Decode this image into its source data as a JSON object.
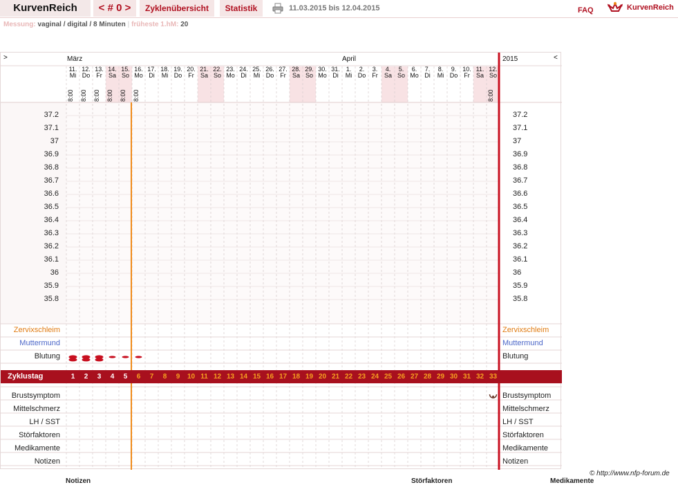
{
  "topbar": {
    "brand": "KurvenReich",
    "nav": "< # 0 >",
    "cycles": "Zyklenübersicht",
    "stats": "Statistik",
    "range": "11.03.2015 bis 12.04.2015",
    "faq": "FAQ",
    "logo": "KurvenReich"
  },
  "info": {
    "measure_label": "Messung:",
    "measure_value": "vaginal / digital / 8 Minuten",
    "sep": "|",
    "earliest_label": "früheste 1.hM:",
    "earliest_value": "20"
  },
  "chart": {
    "left_arrow": ">",
    "right_arrow": "<",
    "month1": "März",
    "month2": "April",
    "year": "2015",
    "days": [
      {
        "d": "11.",
        "w": "Mi",
        "t": "8:00",
        "we": false
      },
      {
        "d": "12.",
        "w": "Do",
        "t": "8:00",
        "we": false
      },
      {
        "d": "13.",
        "w": "Fr",
        "t": "8:00",
        "we": false
      },
      {
        "d": "14.",
        "w": "Sa",
        "t": "8:00",
        "we": true
      },
      {
        "d": "15.",
        "w": "So",
        "t": "8:00",
        "we": true
      },
      {
        "d": "16.",
        "w": "Mo",
        "t": "8:00",
        "we": false
      },
      {
        "d": "17.",
        "w": "Di",
        "t": "",
        "we": false
      },
      {
        "d": "18.",
        "w": "Mi",
        "t": "",
        "we": false
      },
      {
        "d": "19.",
        "w": "Do",
        "t": "",
        "we": false
      },
      {
        "d": "20.",
        "w": "Fr",
        "t": "",
        "we": false
      },
      {
        "d": "21.",
        "w": "Sa",
        "t": "",
        "we": true
      },
      {
        "d": "22.",
        "w": "So",
        "t": "",
        "we": true
      },
      {
        "d": "23.",
        "w": "Mo",
        "t": "",
        "we": false
      },
      {
        "d": "24.",
        "w": "Di",
        "t": "",
        "we": false
      },
      {
        "d": "25.",
        "w": "Mi",
        "t": "",
        "we": false
      },
      {
        "d": "26.",
        "w": "Do",
        "t": "",
        "we": false
      },
      {
        "d": "27.",
        "w": "Fr",
        "t": "",
        "we": false
      },
      {
        "d": "28.",
        "w": "Sa",
        "t": "",
        "we": true
      },
      {
        "d": "29.",
        "w": "So",
        "t": "",
        "we": true
      },
      {
        "d": "30.",
        "w": "Mo",
        "t": "",
        "we": false
      },
      {
        "d": "31.",
        "w": "Di",
        "t": "",
        "we": false
      },
      {
        "d": "1.",
        "w": "Mi",
        "t": "",
        "we": false
      },
      {
        "d": "2.",
        "w": "Do",
        "t": "",
        "we": false
      },
      {
        "d": "3.",
        "w": "Fr",
        "t": "",
        "we": false
      },
      {
        "d": "4.",
        "w": "Sa",
        "t": "",
        "we": true
      },
      {
        "d": "5.",
        "w": "So",
        "t": "",
        "we": true
      },
      {
        "d": "6.",
        "w": "Mo",
        "t": "",
        "we": false
      },
      {
        "d": "7.",
        "w": "Di",
        "t": "",
        "we": false
      },
      {
        "d": "8.",
        "w": "Mi",
        "t": "",
        "we": false
      },
      {
        "d": "9.",
        "w": "Do",
        "t": "",
        "we": false
      },
      {
        "d": "10.",
        "w": "Fr",
        "t": "",
        "we": false
      },
      {
        "d": "11.",
        "w": "Sa",
        "t": "",
        "we": true
      },
      {
        "d": "12.",
        "w": "So",
        "t": "8:00",
        "we": true
      }
    ],
    "temps": [
      "37.2",
      "37.1",
      "37",
      "36.9",
      "36.8",
      "36.7",
      "36.6",
      "36.5",
      "36.4",
      "36.3",
      "36.2",
      "36.1",
      "36",
      "35.9",
      "35.8"
    ],
    "rows_top": {
      "mucus": "Zervixschleim",
      "cervix": "Muttermund",
      "bleeding": "Blutung"
    },
    "bleeding_days": [
      1,
      2,
      3,
      4,
      5,
      6
    ],
    "cycle_label": "Zyklustag",
    "cycle_days": [
      "1",
      "2",
      "3",
      "4",
      "5",
      "6",
      "7",
      "8",
      "9",
      "10",
      "11",
      "12",
      "13",
      "14",
      "15",
      "16",
      "17",
      "18",
      "19",
      "20",
      "21",
      "22",
      "23",
      "24",
      "25",
      "26",
      "27",
      "28",
      "29",
      "30",
      "31",
      "32",
      "33"
    ],
    "rows_bottom": [
      "Brustsymptom",
      "Mittelschmerz",
      "LH / SST",
      "Störfaktoren",
      "Medikamente",
      "Notizen"
    ],
    "breast_symptom_day": 33
  },
  "footer": {
    "copyright": "© http://www.nfp-forum.de",
    "notes": "Notizen",
    "disturb": "Störfaktoren",
    "meds": "Medikamente"
  },
  "colors": {
    "accent": "#a8101e",
    "ovulation": "#f08a18",
    "mucus": "#e07a10",
    "cervix": "#4b66c8"
  }
}
